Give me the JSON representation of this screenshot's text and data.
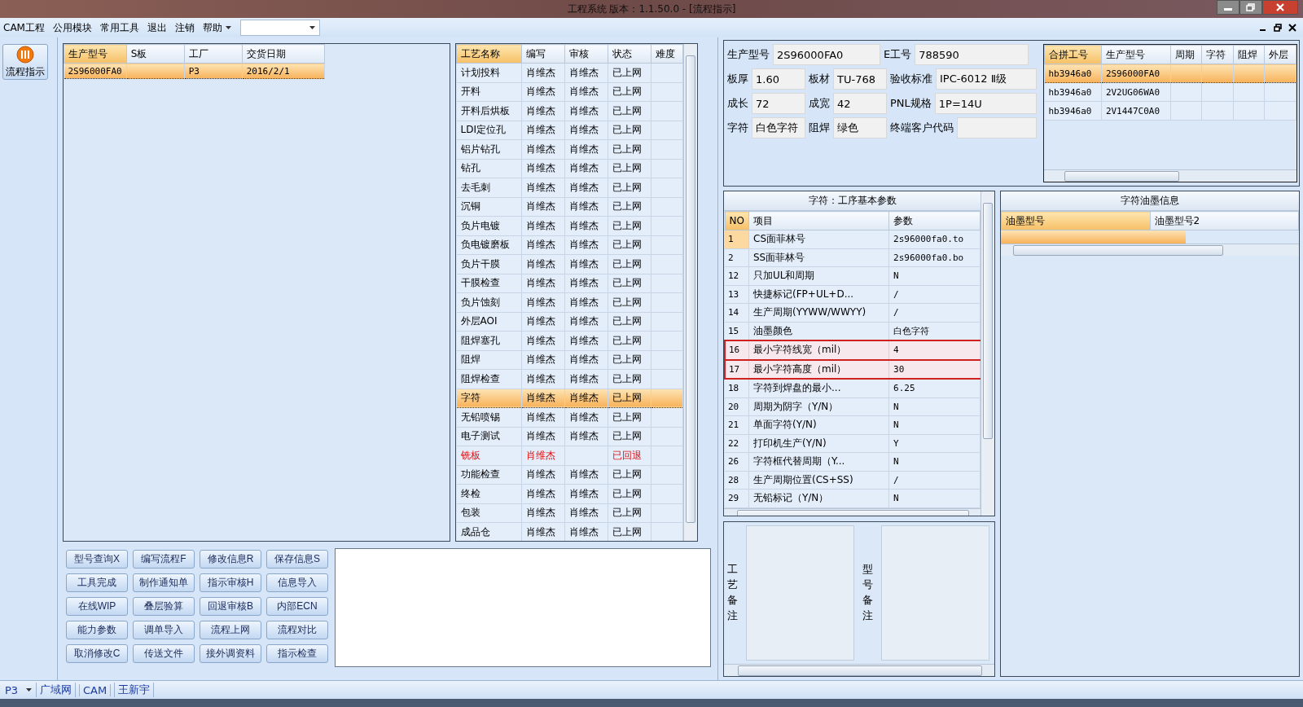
{
  "window": {
    "title": "工程系统   版本：1.1.50.0 - [流程指示]"
  },
  "menu": [
    "CAM工程",
    "公用模块",
    "常用工具",
    "退出",
    "注销",
    "帮助"
  ],
  "sidebar": {
    "button": "流程指示"
  },
  "orders": {
    "columns": [
      "生产型号",
      "S板",
      "工厂",
      "交货日期"
    ],
    "rows": [
      {
        "cells": [
          "2S96000FA0",
          "",
          "P3",
          "2016/2/1"
        ],
        "selected": true
      }
    ]
  },
  "process": {
    "columns": [
      "工艺名称",
      "编写",
      "审核",
      "状态",
      "难度"
    ],
    "rows": [
      {
        "cells": [
          "计划投料",
          "肖维杰",
          "肖维杰",
          "已上网",
          ""
        ],
        "selected": false,
        "returned": false
      },
      {
        "cells": [
          "开料",
          "肖维杰",
          "肖维杰",
          "已上网",
          ""
        ],
        "selected": false,
        "returned": false
      },
      {
        "cells": [
          "开料后烘板",
          "肖维杰",
          "肖维杰",
          "已上网",
          ""
        ],
        "selected": false,
        "returned": false
      },
      {
        "cells": [
          "LDI定位孔",
          "肖维杰",
          "肖维杰",
          "已上网",
          ""
        ],
        "selected": false,
        "returned": false
      },
      {
        "cells": [
          "铝片钻孔",
          "肖维杰",
          "肖维杰",
          "已上网",
          ""
        ],
        "selected": false,
        "returned": false
      },
      {
        "cells": [
          "钻孔",
          "肖维杰",
          "肖维杰",
          "已上网",
          ""
        ],
        "selected": false,
        "returned": false
      },
      {
        "cells": [
          "去毛刺",
          "肖维杰",
          "肖维杰",
          "已上网",
          ""
        ],
        "selected": false,
        "returned": false
      },
      {
        "cells": [
          "沉铜",
          "肖维杰",
          "肖维杰",
          "已上网",
          ""
        ],
        "selected": false,
        "returned": false
      },
      {
        "cells": [
          "负片电镀",
          "肖维杰",
          "肖维杰",
          "已上网",
          ""
        ],
        "selected": false,
        "returned": false
      },
      {
        "cells": [
          "负电镀磨板",
          "肖维杰",
          "肖维杰",
          "已上网",
          ""
        ],
        "selected": false,
        "returned": false
      },
      {
        "cells": [
          "负片干膜",
          "肖维杰",
          "肖维杰",
          "已上网",
          ""
        ],
        "selected": false,
        "returned": false
      },
      {
        "cells": [
          "干膜检查",
          "肖维杰",
          "肖维杰",
          "已上网",
          ""
        ],
        "selected": false,
        "returned": false
      },
      {
        "cells": [
          "负片蚀刻",
          "肖维杰",
          "肖维杰",
          "已上网",
          ""
        ],
        "selected": false,
        "returned": false
      },
      {
        "cells": [
          "外层AOI",
          "肖维杰",
          "肖维杰",
          "已上网",
          ""
        ],
        "selected": false,
        "returned": false
      },
      {
        "cells": [
          "阻焊塞孔",
          "肖维杰",
          "肖维杰",
          "已上网",
          ""
        ],
        "selected": false,
        "returned": false
      },
      {
        "cells": [
          "阻焊",
          "肖维杰",
          "肖维杰",
          "已上网",
          ""
        ],
        "selected": false,
        "returned": false
      },
      {
        "cells": [
          "阻焊检查",
          "肖维杰",
          "肖维杰",
          "已上网",
          ""
        ],
        "selected": false,
        "returned": false
      },
      {
        "cells": [
          "字符",
          "肖维杰",
          "肖维杰",
          "已上网",
          ""
        ],
        "selected": true,
        "returned": false
      },
      {
        "cells": [
          "无铅喷锡",
          "肖维杰",
          "肖维杰",
          "已上网",
          ""
        ],
        "selected": false,
        "returned": false
      },
      {
        "cells": [
          "电子测试",
          "肖维杰",
          "肖维杰",
          "已上网",
          ""
        ],
        "selected": false,
        "returned": false
      },
      {
        "cells": [
          "铣板",
          "肖维杰",
          "",
          "已回退",
          ""
        ],
        "selected": false,
        "returned": true
      },
      {
        "cells": [
          "功能检查",
          "肖维杰",
          "肖维杰",
          "已上网",
          ""
        ],
        "selected": false,
        "returned": false
      },
      {
        "cells": [
          "终检",
          "肖维杰",
          "肖维杰",
          "已上网",
          ""
        ],
        "selected": false,
        "returned": false
      },
      {
        "cells": [
          "包装",
          "肖维杰",
          "肖维杰",
          "已上网",
          ""
        ],
        "selected": false,
        "returned": false
      },
      {
        "cells": [
          "成品仓",
          "肖维杰",
          "肖维杰",
          "已上网",
          ""
        ],
        "selected": false,
        "returned": false
      }
    ]
  },
  "info": [
    [
      {
        "label": "生产型号",
        "value": "2S96000FA0"
      },
      {
        "label": "E工号",
        "value": "788590"
      }
    ],
    [
      {
        "label": "板厚",
        "value": "1.60"
      },
      {
        "label": "板材",
        "value": "TU-768"
      },
      {
        "label": "验收标准",
        "value": "IPC-6012 Ⅱ级"
      }
    ],
    [
      {
        "label": "成长",
        "value": "72"
      },
      {
        "label": "成宽",
        "value": "42"
      },
      {
        "label": "PNL规格",
        "value": "1P=14U"
      }
    ],
    [
      {
        "label": "字符",
        "value": "白色字符"
      },
      {
        "label": "阻焊",
        "value": "绿色"
      },
      {
        "label": "终端客户代码"
      }
    ]
  ],
  "merge": {
    "columns": [
      "合拼工号",
      "生产型号",
      "周期",
      "字符",
      "阻焊",
      "外层"
    ],
    "rows": [
      {
        "cells": [
          "hb3946a0",
          "2S96000FA0",
          "",
          "",
          "",
          ""
        ],
        "selected": true
      },
      {
        "cells": [
          "hb3946a0",
          "2V2UG06WA0",
          "",
          "",
          "",
          ""
        ],
        "selected": false
      },
      {
        "cells": [
          "hb3946a0",
          "2V1447C0A0",
          "",
          "",
          "",
          ""
        ],
        "selected": false
      }
    ]
  },
  "params": {
    "title": "字符：工序基本参数",
    "columns": [
      "NO",
      "项目",
      "参数"
    ],
    "rows": [
      {
        "no": "1",
        "item": "CS面菲林号",
        "value": "2s96000fa0.to",
        "selected": true,
        "highlighted": false
      },
      {
        "no": "2",
        "item": "SS面菲林号",
        "value": "2s96000fa0.bo",
        "selected": false,
        "highlighted": false
      },
      {
        "no": "12",
        "item": "只加UL和周期",
        "value": "N",
        "selected": false,
        "highlighted": false
      },
      {
        "no": "13",
        "item": "快捷标记(FP+UL+D...",
        "value": "/",
        "selected": false,
        "highlighted": false
      },
      {
        "no": "14",
        "item": "生产周期(YYWW/WWYY)",
        "value": "/",
        "selected": false,
        "highlighted": false
      },
      {
        "no": "15",
        "item": "油墨颜色",
        "value": "白色字符",
        "selected": false,
        "highlighted": false
      },
      {
        "no": "16",
        "item": "最小字符线宽（mil）",
        "value": "4",
        "selected": false,
        "highlighted": true
      },
      {
        "no": "17",
        "item": "最小字符高度（mil）",
        "value": "30",
        "selected": false,
        "highlighted": true
      },
      {
        "no": "18",
        "item": "字符到焊盘的最小...",
        "value": "6.25",
        "selected": false,
        "highlighted": false
      },
      {
        "no": "20",
        "item": "周期为阴字（Y/N）",
        "value": "N",
        "selected": false,
        "highlighted": false
      },
      {
        "no": "21",
        "item": "单面字符(Y/N)",
        "value": "N",
        "selected": false,
        "highlighted": false
      },
      {
        "no": "22",
        "item": "打印机生产(Y/N)",
        "value": "Y",
        "selected": false,
        "highlighted": false
      },
      {
        "no": "26",
        "item": "字符框代替周期（Y...",
        "value": "N",
        "selected": false,
        "highlighted": false
      },
      {
        "no": "28",
        "item": "生产周期位置(CS+SS)",
        "value": "/",
        "selected": false,
        "highlighted": false
      },
      {
        "no": "29",
        "item": "无铅标记（Y/N）",
        "value": "N",
        "selected": false,
        "highlighted": false
      }
    ]
  },
  "ink": {
    "title": "字符油墨信息",
    "columns": [
      "油墨型号",
      "油墨型号2"
    ]
  },
  "remarks": [
    "工艺备注",
    "型号备注"
  ],
  "buttons": [
    "型号查询X",
    "编写流程F",
    "修改信息R",
    "保存信息S",
    "工具完成",
    "制作通知单",
    "指示审核H",
    "信息导入",
    "在线WIP",
    "叠层验算",
    "回退审核B",
    "内部ECN",
    "能力参数",
    "调单导入",
    "流程上网",
    "流程对比",
    "取消修改C",
    "传送文件",
    "接外调资料",
    "指示检查"
  ],
  "status_bar": {
    "factory": "P3",
    "items": [
      "广域网",
      "CAM",
      "王新宇"
    ]
  }
}
